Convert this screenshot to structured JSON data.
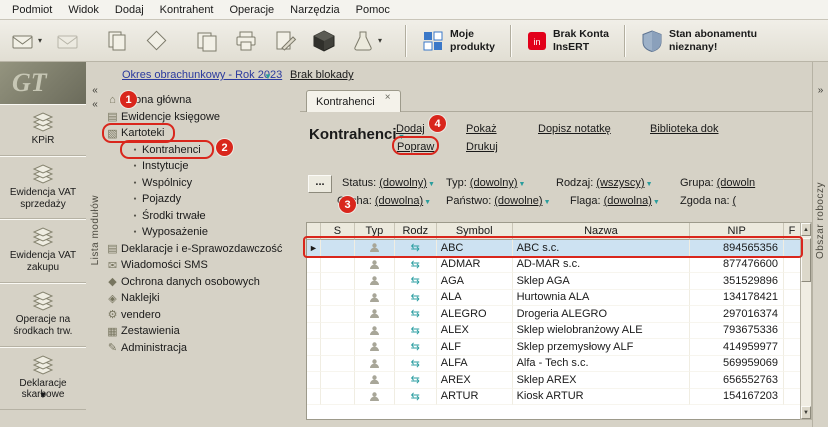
{
  "brand": {
    "logo": "GT"
  },
  "menubar": {
    "items": [
      "Podmiot",
      "Widok",
      "Dodaj",
      "Kontrahent",
      "Operacje",
      "Narzędzia",
      "Pomoc"
    ]
  },
  "toolbar": {
    "icons": [
      "send-mail",
      "mail",
      "copy-document",
      "new-document",
      "documents",
      "print",
      "edit-document",
      "package",
      "lab-flask"
    ],
    "buttons": [
      {
        "line1": "Moje",
        "line2": "produkty"
      },
      {
        "line1": "Brak Konta",
        "line2": "InsERT"
      },
      {
        "line1": "Stan abonamentu",
        "line2": "nieznany!"
      }
    ]
  },
  "period_bar": {
    "period": "Okres obrachunkowy - Rok 2023",
    "lock_status": "Brak blokady"
  },
  "modules_panel": {
    "strip_label": "Lista modułów",
    "items": [
      "KPiR",
      "Ewidencja VAT sprzedaży",
      "Ewidencja VAT zakupu",
      "Operacje na środkach trw.",
      "Deklaracje skarbowe"
    ]
  },
  "tree": {
    "items": [
      "Strona główna",
      "Ewidencje księgowe",
      "Kartoteki",
      "Kontrahenci",
      "Instytucje",
      "Wspólnicy",
      "Pojazdy",
      "Środki trwałe",
      "Wyposażenie",
      "Deklaracje i e-Sprawozdawczość",
      "Wiadomości SMS",
      "Ochrona danych osobowych",
      "Naklejki",
      "vendero",
      "Zestawienia",
      "Administracja"
    ]
  },
  "workspace": {
    "strip_label": "Obszar roboczy",
    "tab_label": "Kontrahenci",
    "title": "Kontrahenci",
    "actions": [
      "Dodaj",
      "Popraw",
      "Pokaż",
      "Drukuj",
      "Dopisz notatkę",
      "Biblioteka dok"
    ],
    "more_filters": "...",
    "filters": [
      {
        "label": "Status:",
        "value": "(dowolny)"
      },
      {
        "label": "Typ:",
        "value": "(dowolny)"
      },
      {
        "label": "Rodzaj:",
        "value": "(wszyscy)"
      },
      {
        "label": "Grupa:",
        "value": "(dowoln"
      },
      {
        "label": "Cecha:",
        "value": "(dowolna)"
      },
      {
        "label": "Państwo:",
        "value": "(dowolne)"
      },
      {
        "label": "Flaga:",
        "value": "(dowolna)"
      },
      {
        "label": "Zgoda na:",
        "value": "("
      }
    ],
    "table": {
      "columns": [
        "S",
        "Typ",
        "Rodz",
        "Symbol",
        "Nazwa",
        "NIP",
        "F"
      ],
      "rows": [
        {
          "symbol": "ABC",
          "nazwa": "ABC s.c.",
          "nip": "894565356",
          "selected": true
        },
        {
          "symbol": "ADMAR",
          "nazwa": "AD-MAR s.c.",
          "nip": "877476600"
        },
        {
          "symbol": "AGA",
          "nazwa": "Sklep AGA",
          "nip": "351529896"
        },
        {
          "symbol": "ALA",
          "nazwa": "Hurtownia ALA",
          "nip": "134178421"
        },
        {
          "symbol": "ALEGRO",
          "nazwa": "Drogeria ALEGRO",
          "nip": "297016374"
        },
        {
          "symbol": "ALEX",
          "nazwa": "Sklep wielobranżowy ALE",
          "nip": "793675336"
        },
        {
          "symbol": "ALF",
          "nazwa": "Sklep przemysłowy ALF",
          "nip": "414959977"
        },
        {
          "symbol": "ALFA",
          "nazwa": "Alfa - Tech s.c.",
          "nip": "569959069"
        },
        {
          "symbol": "AREX",
          "nazwa": "Sklep AREX",
          "nip": "656552763"
        },
        {
          "symbol": "ARTUR",
          "nazwa": "Kiosk ARTUR",
          "nip": "154167203"
        }
      ]
    }
  },
  "annotations": {
    "steps": [
      "1",
      "2",
      "3",
      "4"
    ]
  },
  "colors": {
    "annotation_red": "#d9261c",
    "accent_teal": "#2a9d9d",
    "selection_blue": "#cde2f2",
    "insert_red": "#e2001a"
  }
}
